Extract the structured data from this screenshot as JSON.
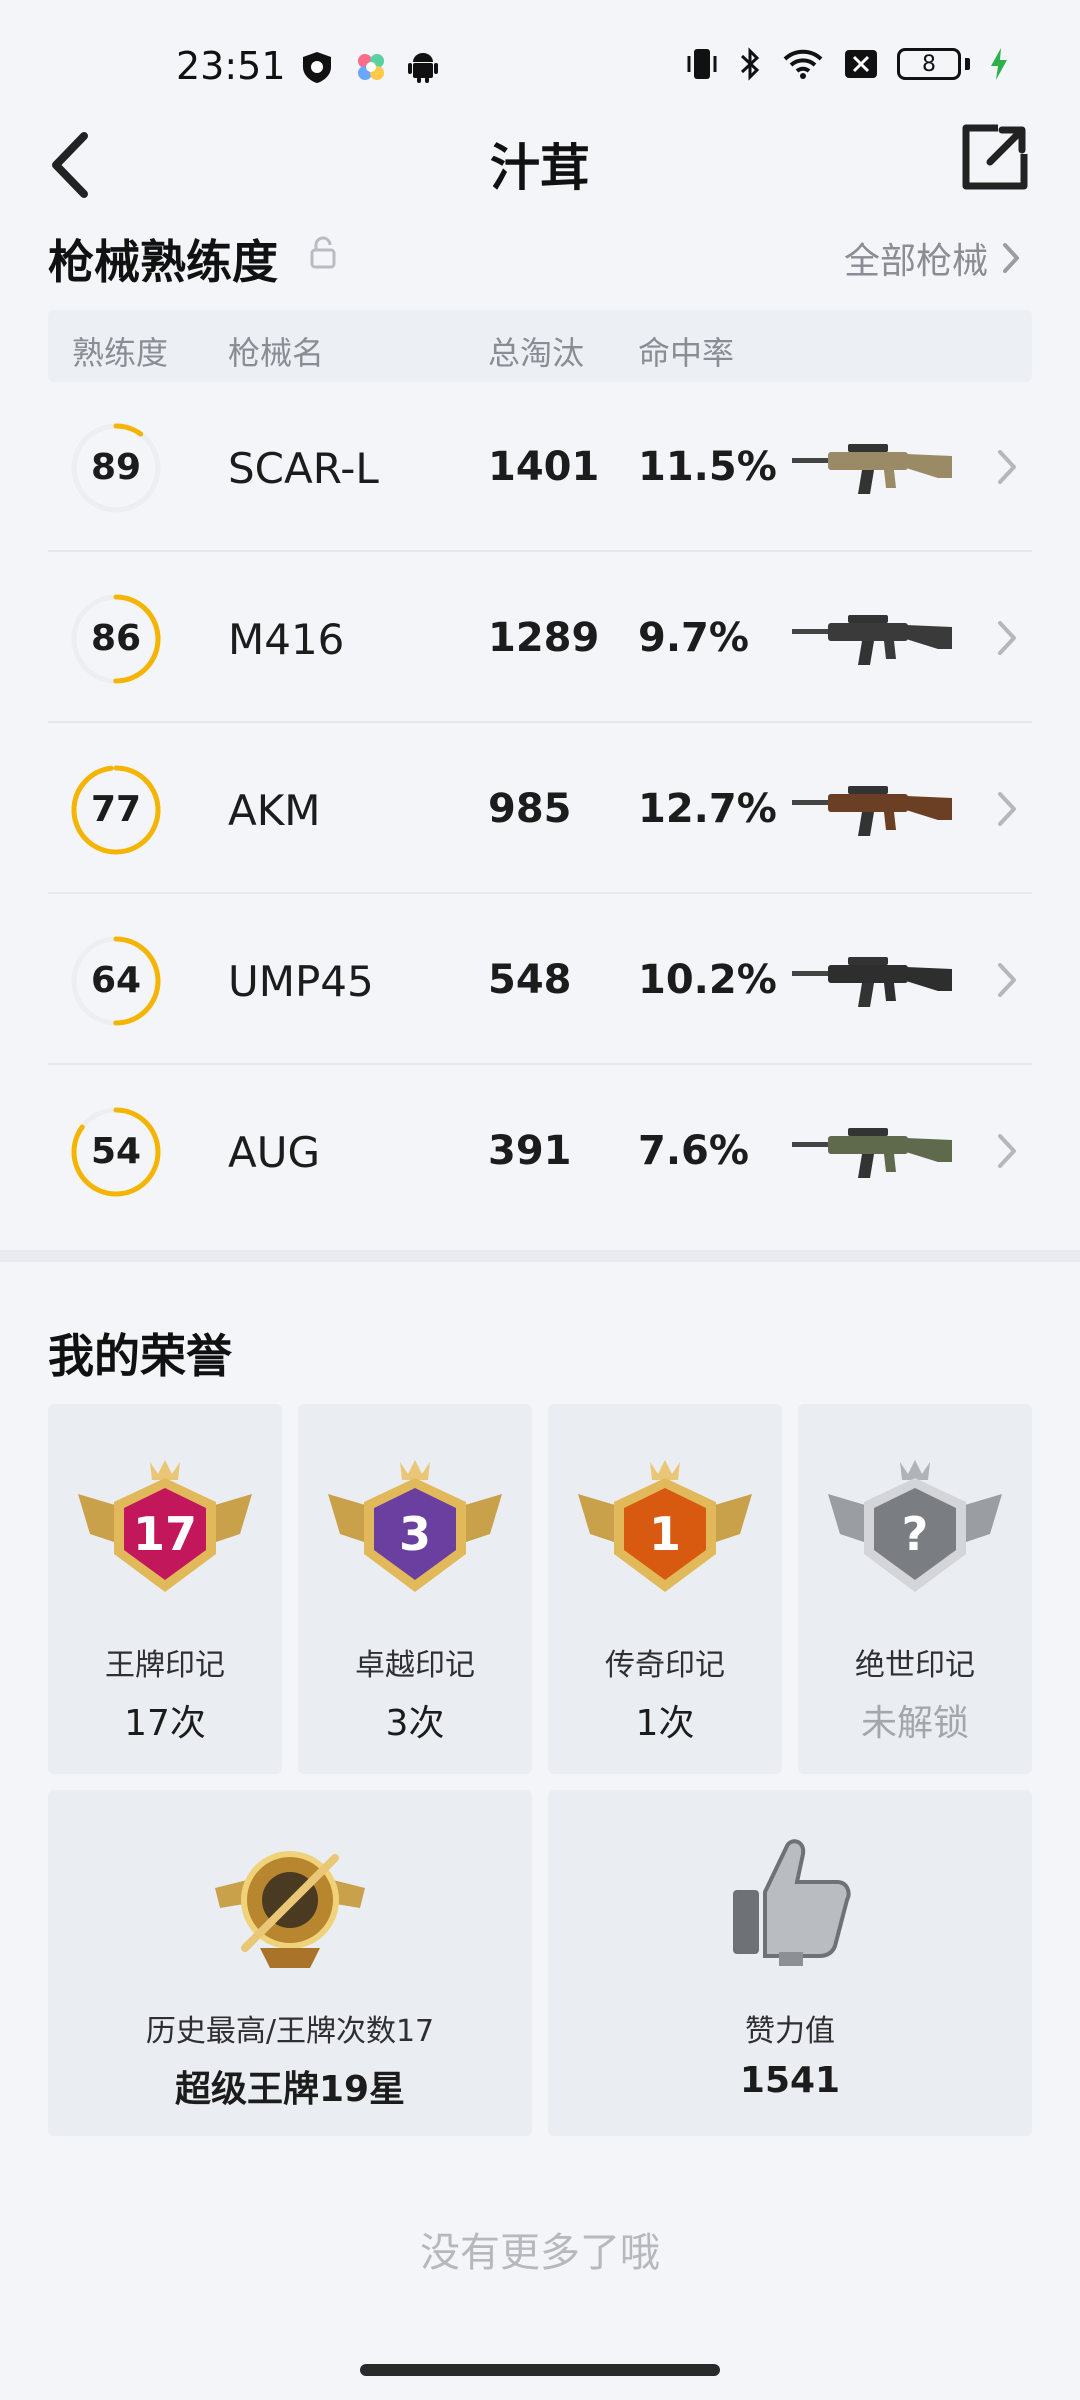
{
  "status_bar": {
    "time": "23:51",
    "battery": "8"
  },
  "header": {
    "title": "汁茸"
  },
  "weapons_section": {
    "title": "枪械熟练度",
    "all_link": "全部枪械",
    "columns": [
      "熟练度",
      "枪械名",
      "总淘汰",
      "命中率"
    ],
    "rows": [
      {
        "proficiency": "89",
        "progress": 0.1,
        "name": "SCAR-L",
        "kills": "1401",
        "hit_rate": "11.5%",
        "gun_color": "#9a8a66"
      },
      {
        "proficiency": "86",
        "progress": 0.5,
        "name": "M416",
        "kills": "1289",
        "hit_rate": "9.7%",
        "gun_color": "#3a3a3a"
      },
      {
        "proficiency": "77",
        "progress": 0.98,
        "name": "AKM",
        "kills": "985",
        "hit_rate": "12.7%",
        "gun_color": "#6b3f24"
      },
      {
        "proficiency": "64",
        "progress": 0.5,
        "name": "UMP45",
        "kills": "548",
        "hit_rate": "10.2%",
        "gun_color": "#2e2e2e"
      },
      {
        "proficiency": "54",
        "progress": 0.85,
        "name": "AUG",
        "kills": "391",
        "hit_rate": "7.6%",
        "gun_color": "#5f6a4c"
      }
    ]
  },
  "honors_section": {
    "title": "我的荣誉",
    "badges": [
      {
        "label": "王牌印记",
        "value": "17次",
        "badge_number": "17",
        "color": "#c2185b"
      },
      {
        "label": "卓越印记",
        "value": "3次",
        "badge_number": "3",
        "color": "#6a3fa0"
      },
      {
        "label": "传奇印记",
        "value": "1次",
        "badge_number": "1",
        "color": "#d85a10"
      },
      {
        "label": "绝世印记",
        "value": "未解锁",
        "badge_number": "?",
        "color": "#7a7d82"
      }
    ],
    "big_cards": [
      {
        "label": "历史最高/王牌次数17",
        "value": "超级王牌19星"
      },
      {
        "label": "赞力值",
        "value": "1541"
      }
    ]
  },
  "footer": {
    "no_more": "没有更多了哦"
  },
  "colors": {
    "accent": "#f5b400",
    "ring_track": "#eceef2",
    "background": "#f3f5f9"
  }
}
